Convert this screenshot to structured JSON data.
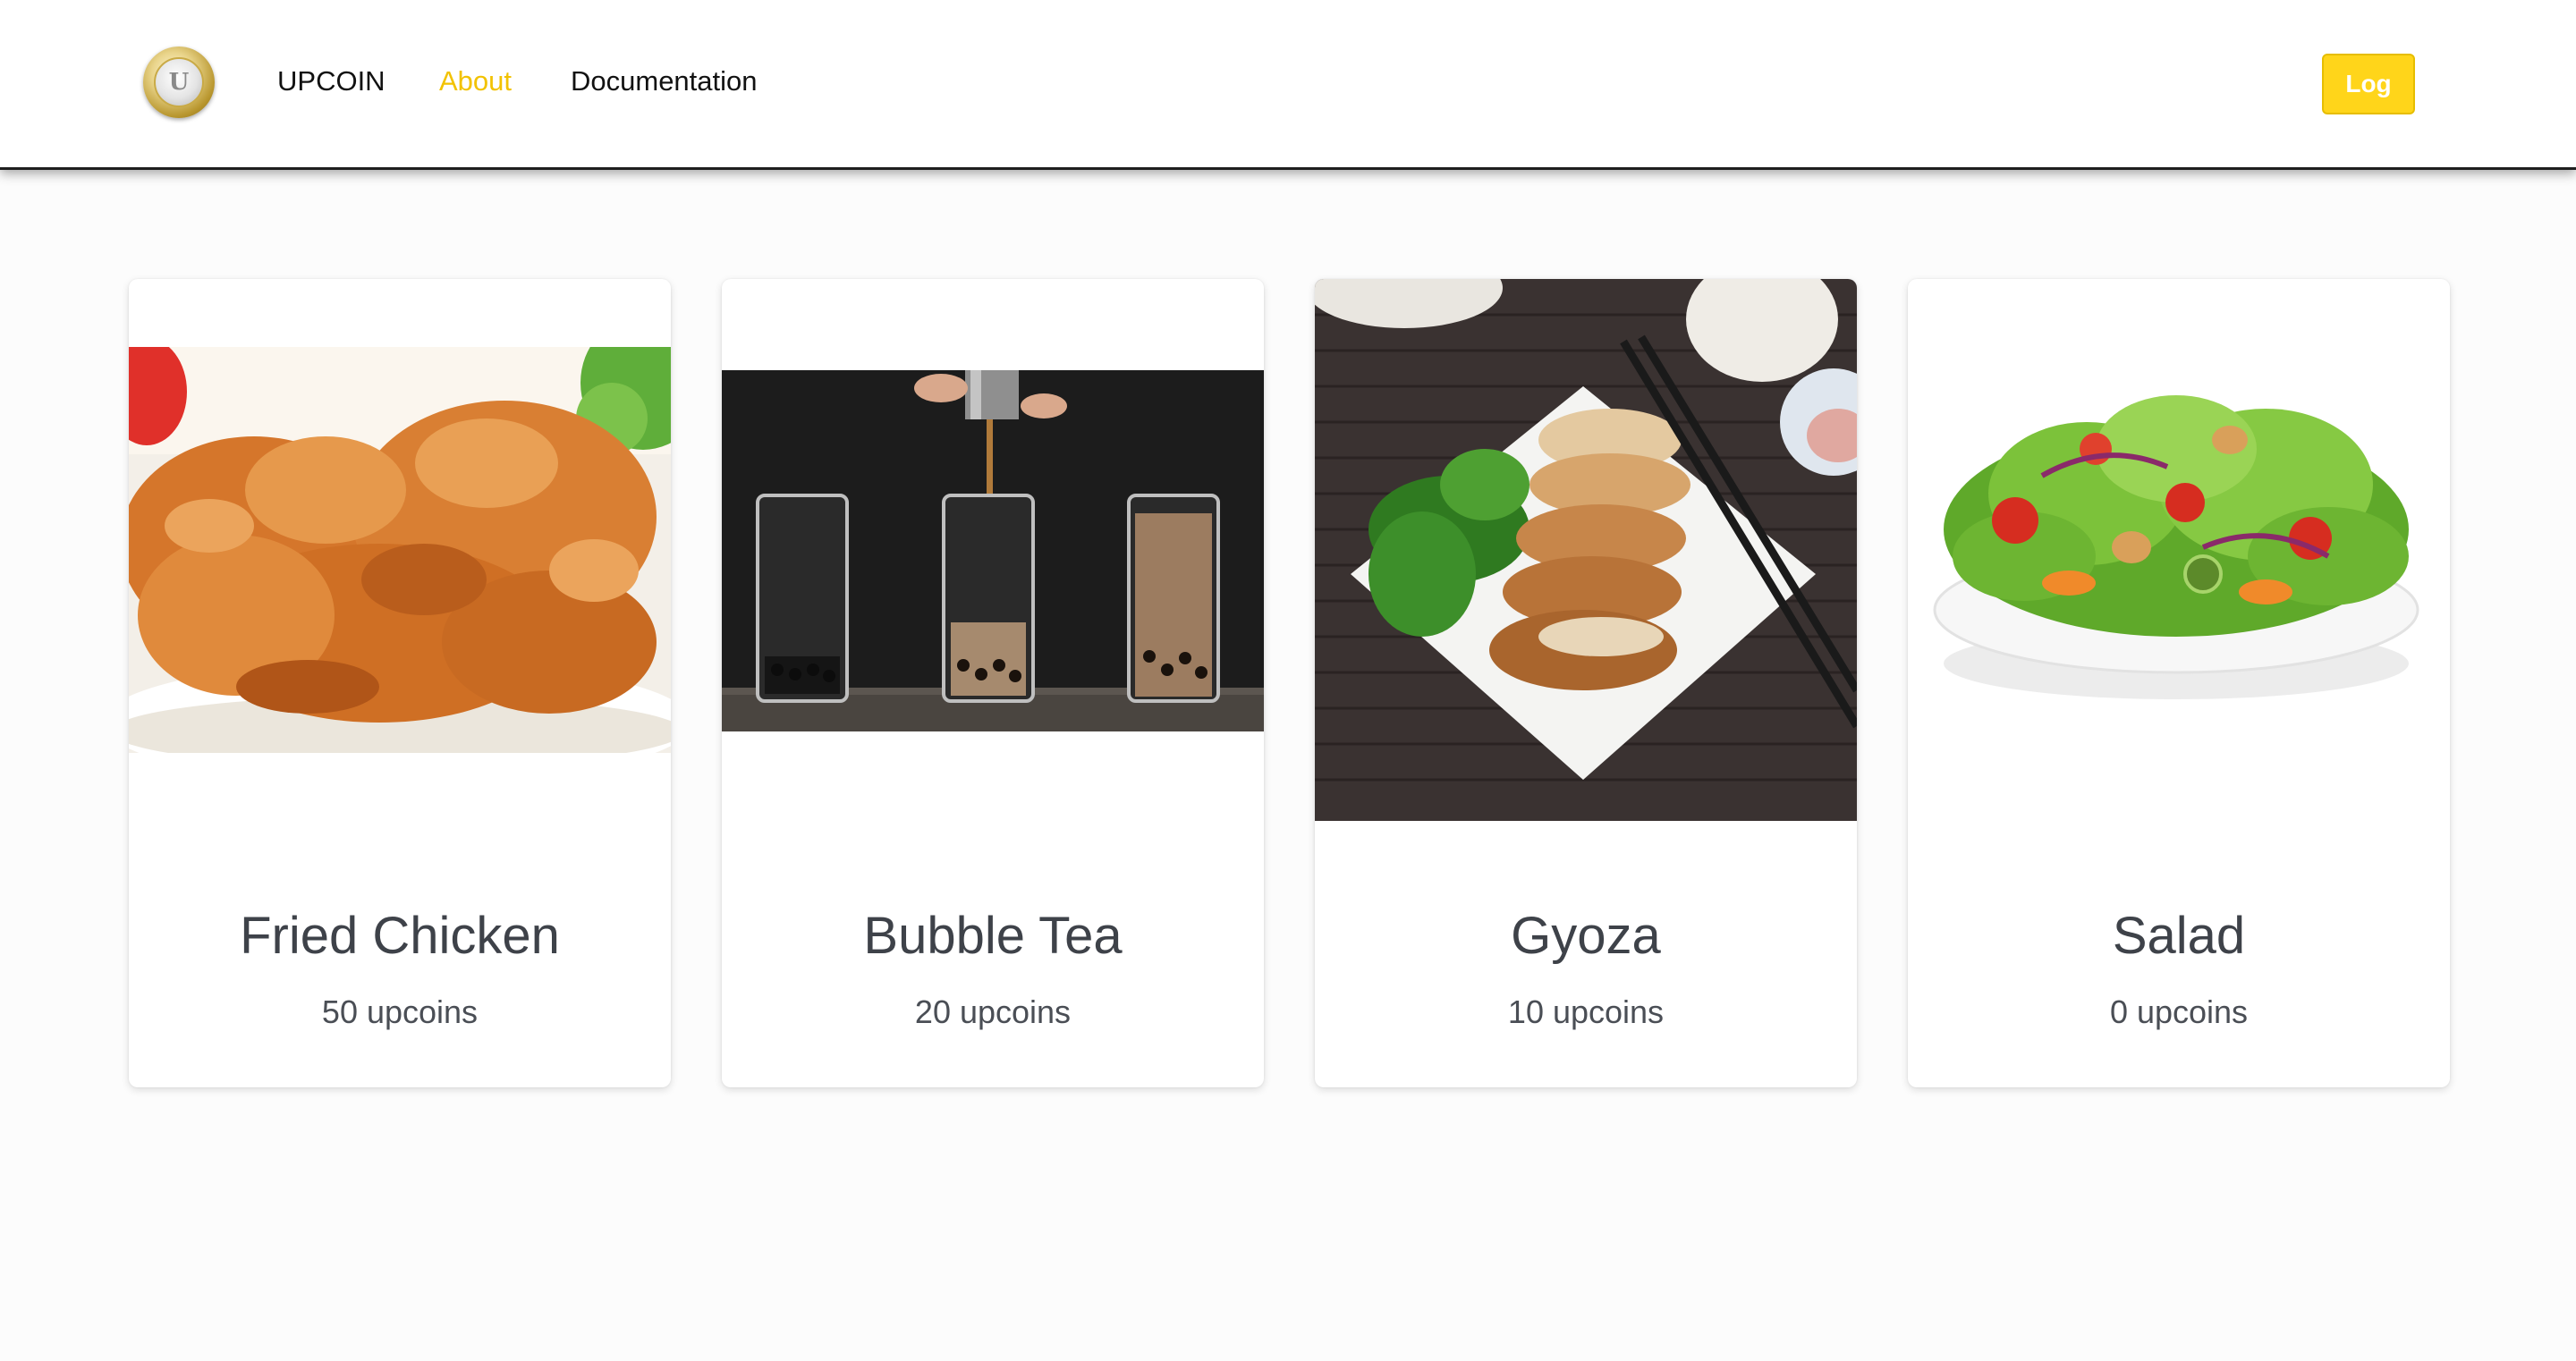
{
  "navbar": {
    "logo_icon": "upcoin-coin-logo",
    "brand": "UPCOIN",
    "links": [
      {
        "label": "About",
        "active": true
      },
      {
        "label": "Documentation",
        "active": false
      }
    ],
    "log_button": "Log",
    "accent_color": "#ffd51a",
    "active_link_color": "#f2c200"
  },
  "products": [
    {
      "name": "Fried Chicken",
      "price": "50 upcoins",
      "image_icon": "fried-chicken-photo"
    },
    {
      "name": "Bubble Tea",
      "price": "20 upcoins",
      "image_icon": "bubble-tea-photo"
    },
    {
      "name": "Gyoza",
      "price": "10 upcoins",
      "image_icon": "gyoza-photo"
    },
    {
      "name": "Salad",
      "price": "0 upcoins",
      "image_icon": "salad-photo"
    }
  ]
}
